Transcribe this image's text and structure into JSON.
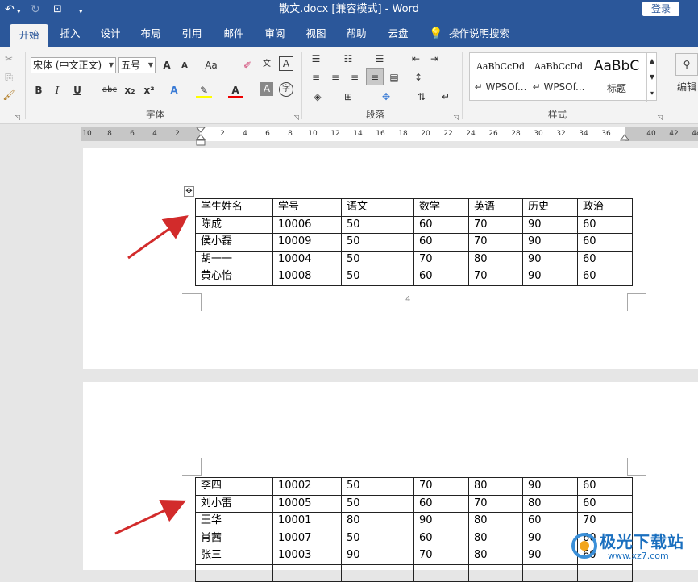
{
  "titlebar": {
    "title": "散文.docx [兼容模式]  -  Word",
    "login": "登录",
    "qa_icons": [
      "undo-icon",
      "redo-icon",
      "touch-mode-icon",
      "customize-icon"
    ]
  },
  "tabs": [
    "开始",
    "插入",
    "设计",
    "布局",
    "引用",
    "邮件",
    "审阅",
    "视图",
    "帮助",
    "云盘",
    "操作说明搜索"
  ],
  "ribbon": {
    "font_name": "宋体 (中文正文)",
    "font_size": "五号",
    "group_font": "字体",
    "group_paragraph": "段落",
    "group_styles": "样式",
    "edit_label": "编辑",
    "font_buttons": [
      "A",
      "A",
      "Aa"
    ],
    "format_buttons": [
      "B",
      "I",
      "U",
      "abc",
      "x₂",
      "x²"
    ],
    "styles": [
      {
        "sample": "AaBbCcDd",
        "name": "↵ WPSOf..."
      },
      {
        "sample": "AaBbCcDd",
        "name": "↵ WPSOf..."
      },
      {
        "sample": "AaBbC",
        "name": "标题"
      }
    ]
  },
  "ruler": {
    "ticks": [
      "10",
      "8",
      "6",
      "4",
      "2",
      "2",
      "4",
      "6",
      "8",
      "10",
      "12",
      "14",
      "16",
      "18",
      "20",
      "22",
      "24",
      "26",
      "28",
      "30",
      "32",
      "34",
      "36",
      "40",
      "42",
      "44"
    ]
  },
  "page1": {
    "page_number": "4",
    "table": [
      [
        "学生姓名",
        "学号",
        "语文",
        "数学",
        "英语",
        "历史",
        "政治"
      ],
      [
        "陈成",
        "10006",
        "50",
        "60",
        "70",
        "90",
        "60"
      ],
      [
        "侯小磊",
        "10009",
        "50",
        "60",
        "70",
        "90",
        "60"
      ],
      [
        "胡一一",
        "10004",
        "50",
        "70",
        "80",
        "90",
        "60"
      ],
      [
        "黄心怡",
        "10008",
        "50",
        "60",
        "70",
        "90",
        "60"
      ]
    ]
  },
  "page2": {
    "table": [
      [
        "李四",
        "10002",
        "50",
        "70",
        "80",
        "90",
        "60"
      ],
      [
        "刘小雷",
        "10005",
        "50",
        "60",
        "70",
        "80",
        "60"
      ],
      [
        "王华",
        "10001",
        "80",
        "90",
        "80",
        "60",
        "70"
      ],
      [
        "肖茜",
        "10007",
        "50",
        "60",
        "80",
        "90",
        "60"
      ],
      [
        "张三",
        "10003",
        "90",
        "70",
        "80",
        "90",
        "60"
      ],
      [
        "",
        "",
        "",
        "",
        "",
        "",
        ""
      ]
    ]
  },
  "watermark": {
    "text": "极光下载站",
    "url": "www.xz7.com"
  },
  "colors": {
    "brand": "#2b579a",
    "arrow": "#d22b2b"
  }
}
